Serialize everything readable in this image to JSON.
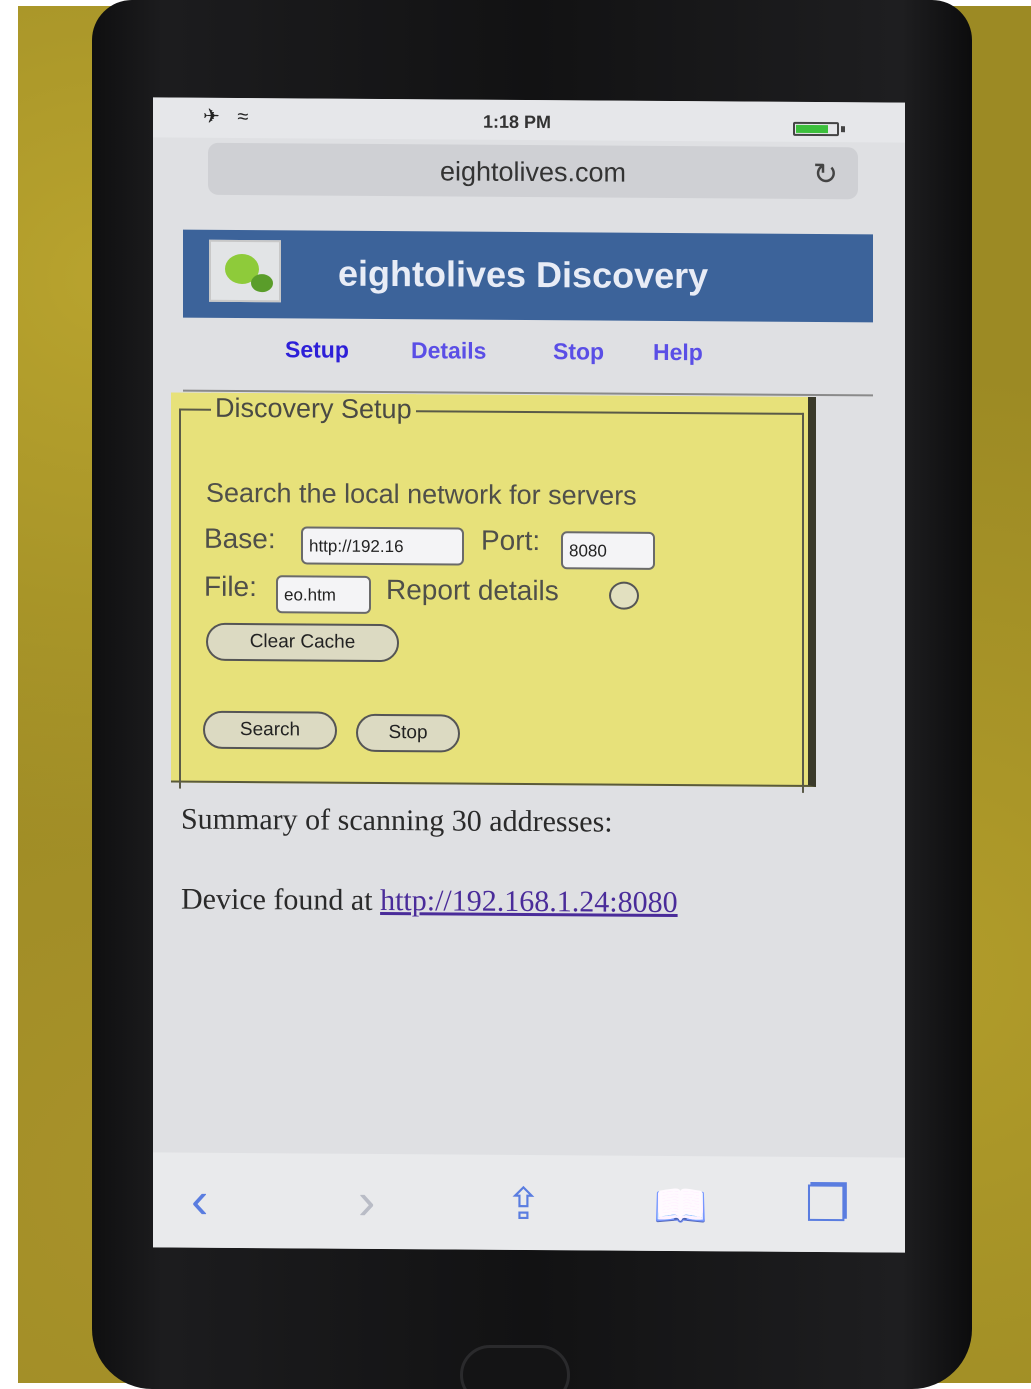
{
  "status": {
    "left_icons": "✈ ≈",
    "time": "1:18 PM",
    "battery_level": 0.8,
    "battery_color": "#3cbf3c"
  },
  "browser": {
    "url": "eightolives.com",
    "reload_icon": "reload-icon"
  },
  "site": {
    "title": "eightolives Discovery",
    "header_color": "#3c639a"
  },
  "nav": {
    "items": [
      "Setup",
      "Details",
      "Stop",
      "Help"
    ],
    "active": "Setup"
  },
  "setup": {
    "legend": "Discovery Setup",
    "description": "Search the local network for servers",
    "base_label": "Base:",
    "base_value": "http://192.16",
    "port_label": "Port:",
    "port_value": "8080",
    "file_label": "File:",
    "file_value": "eo.htm",
    "report_label": "Report details",
    "report_checked": false,
    "clear_cache_label": "Clear Cache",
    "search_label": "Search",
    "stop_label": "Stop",
    "panel_color": "#e7e17a"
  },
  "results": {
    "summary": "Summary of scanning 30 addresses:",
    "found_prefix": "Device found at ",
    "found_link": "http://192.168.1.24:8080"
  },
  "toolbar": {
    "back": "‹",
    "forward": "›",
    "share": "⇪",
    "bookmarks": "📖",
    "tabs": "❐",
    "accent": "#5a7de0"
  }
}
